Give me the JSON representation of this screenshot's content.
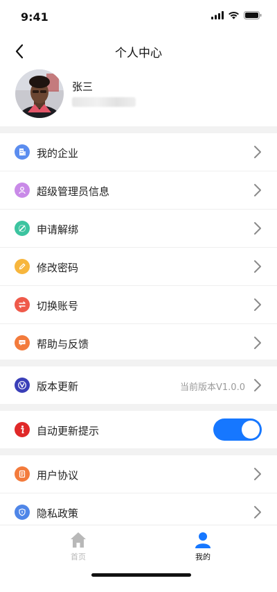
{
  "status_bar": {
    "time": "9:41"
  },
  "header": {
    "title": "个人中心"
  },
  "profile": {
    "name": "张三"
  },
  "menu_group_1": [
    {
      "label": "我的企业",
      "icon": "building-icon",
      "color": "#5b8def"
    },
    {
      "label": "超级管理员信息",
      "icon": "admin-user-icon",
      "color": "#c98ae8"
    },
    {
      "label": "申请解绑",
      "icon": "unbind-icon",
      "color": "#3cc4a0"
    },
    {
      "label": "修改密码",
      "icon": "pencil-icon",
      "color": "#f7b63d"
    },
    {
      "label": "切换账号",
      "icon": "switch-icon",
      "color": "#ef5a4a"
    },
    {
      "label": "帮助与反馈",
      "icon": "chat-icon",
      "color": "#f37b3c"
    }
  ],
  "version_row": {
    "label": "版本更新",
    "value": "当前版本V1.0.0",
    "icon": "version-icon",
    "color": "#3a3fb8"
  },
  "auto_update_row": {
    "label": "自动更新提示",
    "icon": "info-icon",
    "color": "#e02828",
    "toggle_on": true,
    "toggle_color": "#1677ff"
  },
  "menu_group_3": [
    {
      "label": "用户协议",
      "icon": "document-icon",
      "color": "#f37b3c"
    },
    {
      "label": "隐私政策",
      "icon": "shield-icon",
      "color": "#4f86e8"
    }
  ],
  "tab_bar": {
    "home_label": "首页",
    "mine_label": "我的",
    "active_color": "#1677ff",
    "inactive_color": "#b8b8b8"
  }
}
